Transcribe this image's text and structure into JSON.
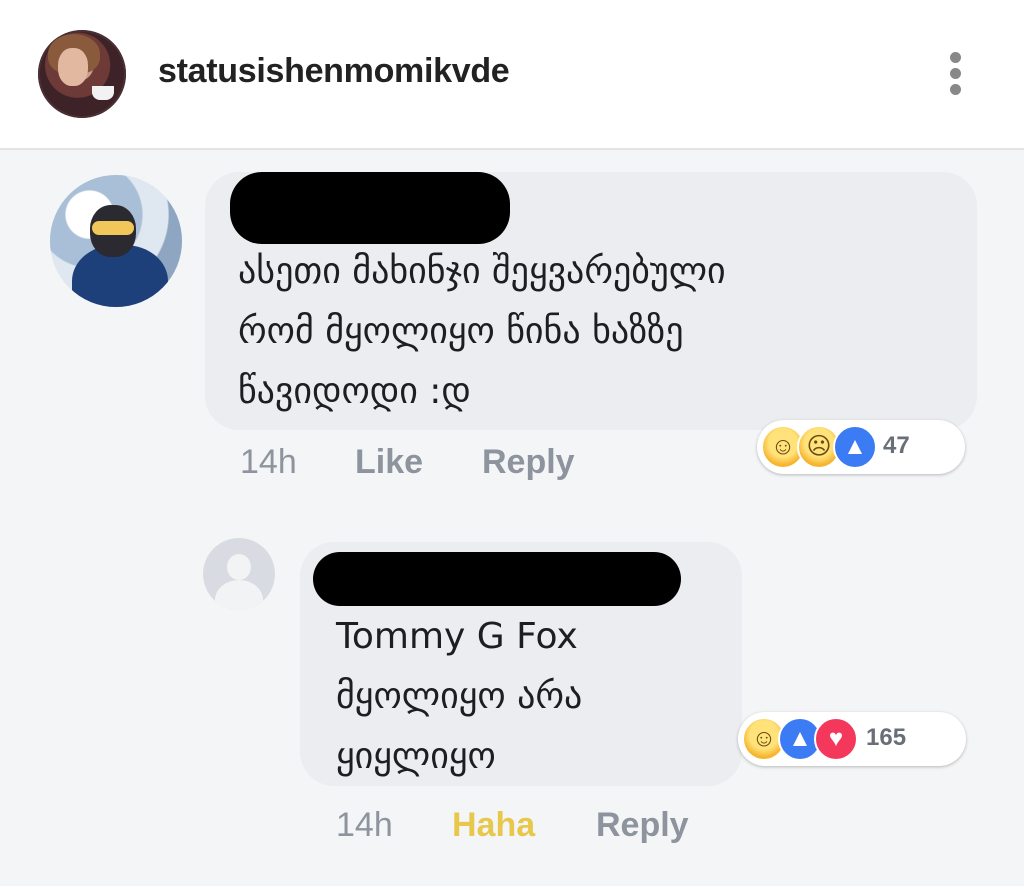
{
  "header": {
    "username": "statusishenmomikvde",
    "menu_icon": "more-vertical-icon"
  },
  "comments": [
    {
      "lines": [
        "ასეთი მახინჯი შეყვარებული",
        "რომ მყოლიყო წინა ხაზზე",
        "წავიდოდი :დ"
      ],
      "time": "14h",
      "like_label": "Like",
      "reply_label": "Reply",
      "reactions": [
        "haha-icon",
        "sad-icon",
        "like-icon"
      ],
      "reaction_count": "47"
    },
    {
      "lines": [
        "Tommy G Fox",
        "მყოლიყო არა",
        "ყიყლიყო"
      ],
      "time": "14h",
      "like_label": "Haha",
      "reply_label": "Reply",
      "reactions": [
        "haha-icon",
        "like-icon",
        "love-icon"
      ],
      "reaction_count": "165"
    }
  ],
  "colors": {
    "bubble": "#ebedf0",
    "meta_text": "#8d949e",
    "haha_active": "#e7c84b",
    "like_blue": "#3b7bf3",
    "love_red": "#f3385c"
  }
}
